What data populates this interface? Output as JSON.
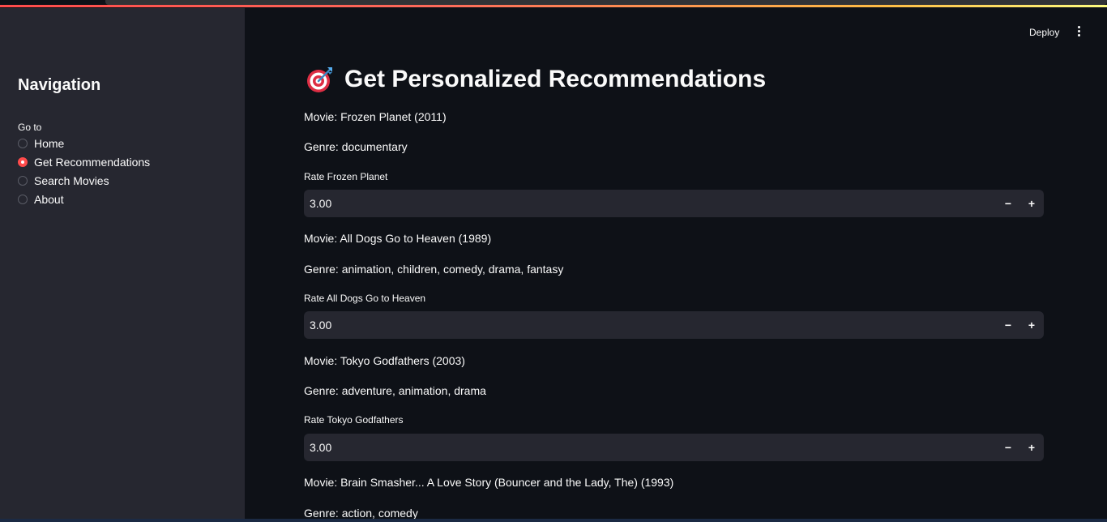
{
  "header": {
    "deploy_label": "Deploy"
  },
  "sidebar": {
    "title": "Navigation",
    "radio_label": "Go to",
    "options": [
      {
        "label": "Home",
        "selected": false
      },
      {
        "label": "Get Recommendations",
        "selected": true
      },
      {
        "label": "Search Movies",
        "selected": false
      },
      {
        "label": "About",
        "selected": false
      }
    ]
  },
  "main": {
    "title": "Get Personalized Recommendations",
    "title_icon": "target-dart-icon",
    "movies": [
      {
        "movie_line": "Movie: Frozen Planet (2011)",
        "genre_line": "Genre: documentary",
        "rate_label": "Rate Frozen Planet",
        "rating": "3.00"
      },
      {
        "movie_line": "Movie: All Dogs Go to Heaven (1989)",
        "genre_line": "Genre: animation, children, comedy, drama, fantasy",
        "rate_label": "Rate All Dogs Go to Heaven",
        "rating": "3.00"
      },
      {
        "movie_line": "Movie: Tokyo Godfathers (2003)",
        "genre_line": "Genre: adventure, animation, drama",
        "rate_label": "Rate Tokyo Godfathers",
        "rating": "3.00"
      },
      {
        "movie_line": "Movie: Brain Smasher... A Love Story (Bouncer and the Lady, The) (1993)",
        "genre_line": "Genre: action, comedy"
      }
    ],
    "stepper": {
      "minus": "−",
      "plus": "+"
    }
  },
  "colors": {
    "accent": "#ff4b4b",
    "background": "#0e1117",
    "sidebar": "#262730",
    "input": "#262730"
  }
}
